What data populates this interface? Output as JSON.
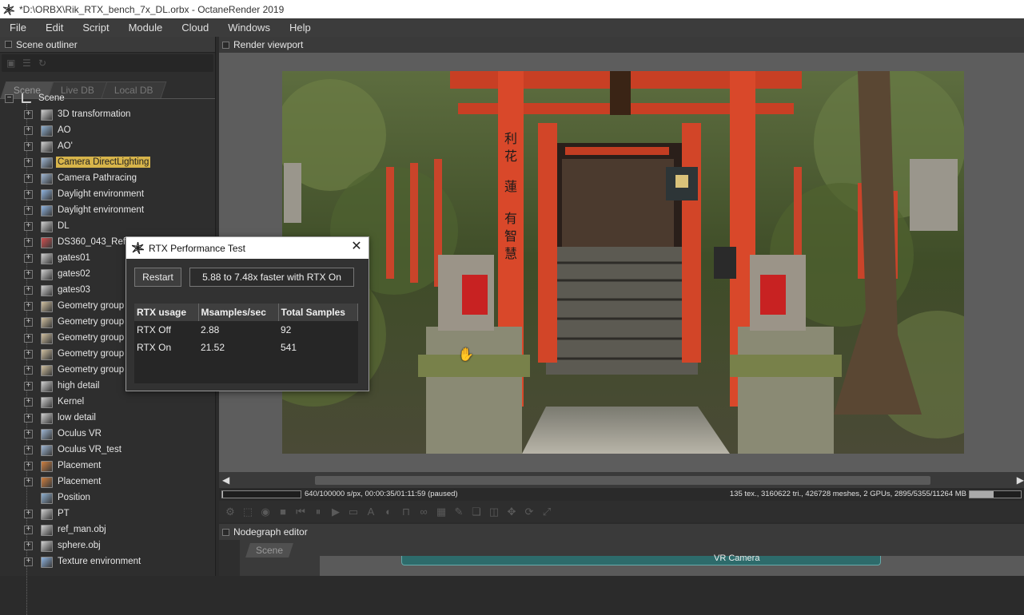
{
  "window": {
    "title": "*D:\\ORBX\\Rik_RTX_bench_7x_DL.orbx - OctaneRender 2019",
    "icon": "octane-logo-icon"
  },
  "menubar": {
    "items": [
      "File",
      "Edit",
      "Script",
      "Module",
      "Cloud",
      "Windows",
      "Help"
    ]
  },
  "outliner": {
    "title": "Scene outliner",
    "tabs": [
      "Scene",
      "Live DB",
      "Local DB"
    ],
    "root": "Scene",
    "items": [
      {
        "label": "3D transformation",
        "icon": "transform-icon",
        "expandable": true
      },
      {
        "label": "AO",
        "icon": "kernel-icon",
        "expandable": true
      },
      {
        "label": "AO'",
        "icon": "kernel-grid-icon",
        "expandable": true
      },
      {
        "label": "Camera DirectLighting",
        "icon": "camera-node-icon",
        "expandable": true,
        "selected": true
      },
      {
        "label": "Camera Pathracing",
        "icon": "camera-node-icon",
        "expandable": true
      },
      {
        "label": "Daylight environment",
        "icon": "environment-icon",
        "expandable": true
      },
      {
        "label": "Daylight environment",
        "icon": "environment-icon",
        "expandable": true
      },
      {
        "label": "DL",
        "icon": "kernel-grid-icon",
        "expandable": true
      },
      {
        "label": "DS360_043_Ref.h",
        "icon": "image-texture-icon",
        "expandable": true
      },
      {
        "label": "gates01",
        "icon": "geometry-icon",
        "expandable": true
      },
      {
        "label": "gates02",
        "icon": "geometry-icon",
        "expandable": true
      },
      {
        "label": "gates03",
        "icon": "geometry-icon",
        "expandable": true
      },
      {
        "label": "Geometry group",
        "icon": "geometry-group-icon",
        "expandable": true
      },
      {
        "label": "Geometry group",
        "icon": "geometry-group-icon",
        "expandable": true
      },
      {
        "label": "Geometry group",
        "icon": "geometry-group-icon",
        "expandable": true
      },
      {
        "label": "Geometry group",
        "icon": "geometry-group-icon",
        "expandable": true
      },
      {
        "label": "Geometry group",
        "icon": "geometry-group-icon",
        "expandable": true
      },
      {
        "label": "high detail",
        "icon": "geometry-icon",
        "expandable": true
      },
      {
        "label": "Kernel",
        "icon": "kernel-grid-icon",
        "expandable": true
      },
      {
        "label": "low detail",
        "icon": "geometry-icon",
        "expandable": true
      },
      {
        "label": "Oculus VR",
        "icon": "camera-node-icon",
        "expandable": true
      },
      {
        "label": "Oculus VR_test",
        "icon": "camera-node-icon",
        "expandable": true
      },
      {
        "label": "Placement",
        "icon": "placement-icon",
        "expandable": true
      },
      {
        "label": "Placement",
        "icon": "placement-icon",
        "expandable": true
      },
      {
        "label": "Position",
        "icon": "position-icon",
        "expandable": false
      },
      {
        "label": "PT",
        "icon": "kernel-grid-icon",
        "expandable": true
      },
      {
        "label": "ref_man.obj",
        "icon": "mesh-icon",
        "expandable": true
      },
      {
        "label": "sphere.obj",
        "icon": "mesh-icon",
        "expandable": true
      },
      {
        "label": "Texture environment",
        "icon": "environment-icon",
        "expandable": true
      }
    ]
  },
  "viewport": {
    "title": "Render viewport",
    "status_left": "640/100000 s/px, 00:00:35/01:11:59 (paused)",
    "status_right": "135 tex., 3160622 tri., 426728 meshes, 2 GPUs, 2895/5355/11264 MB",
    "render_progress": 0.0064,
    "gpu_memory_fill": 0.47
  },
  "nodegraph": {
    "title": "Nodegraph editor",
    "tab": "Scene",
    "node_title": "VR Camera"
  },
  "dialog": {
    "title": "RTX Performance Test",
    "restart_label": "Restart",
    "result_text": "5.88 to 7.48x faster with RTX On",
    "columns": [
      "RTX usage",
      "Msamples/sec",
      "Total Samples"
    ],
    "rows": [
      {
        "usage": "RTX Off",
        "msamples": "2.88",
        "total": "92"
      },
      {
        "usage": "RTX On",
        "msamples": "21.52",
        "total": "541"
      }
    ]
  },
  "colors": {
    "selection": "#d7b44a",
    "panel_bg": "#2e2e2e",
    "header_bg": "#3a3a3a",
    "torii_red": "#d9482a"
  }
}
